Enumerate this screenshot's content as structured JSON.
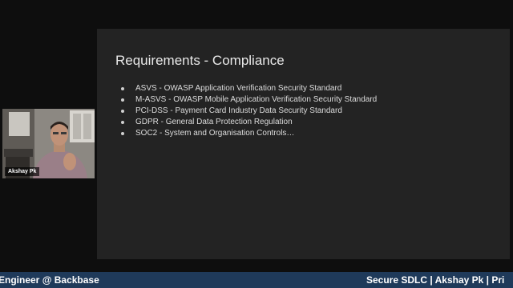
{
  "slide": {
    "title": "Requirements - Compliance",
    "bullets": [
      "ASVS - OWASP Application Verification Security Standard",
      "M-ASVS - OWASP Mobile Application Verification Security Standard",
      "PCI-DSS - Payment Card Industry Data Security Standard",
      "GDPR - General Data Protection Regulation",
      "SOC2 - System and Organisation Controls…"
    ]
  },
  "speaker": {
    "name": "Akshay Pk"
  },
  "ticker": {
    "left_text": "s Engineer @ Backbase",
    "right_text": "Secure SDLC | Akshay Pk | Pri"
  },
  "colors": {
    "background": "#0e0e0e",
    "slide_background": "#232323",
    "ticker_background": "#1f3a5a"
  }
}
